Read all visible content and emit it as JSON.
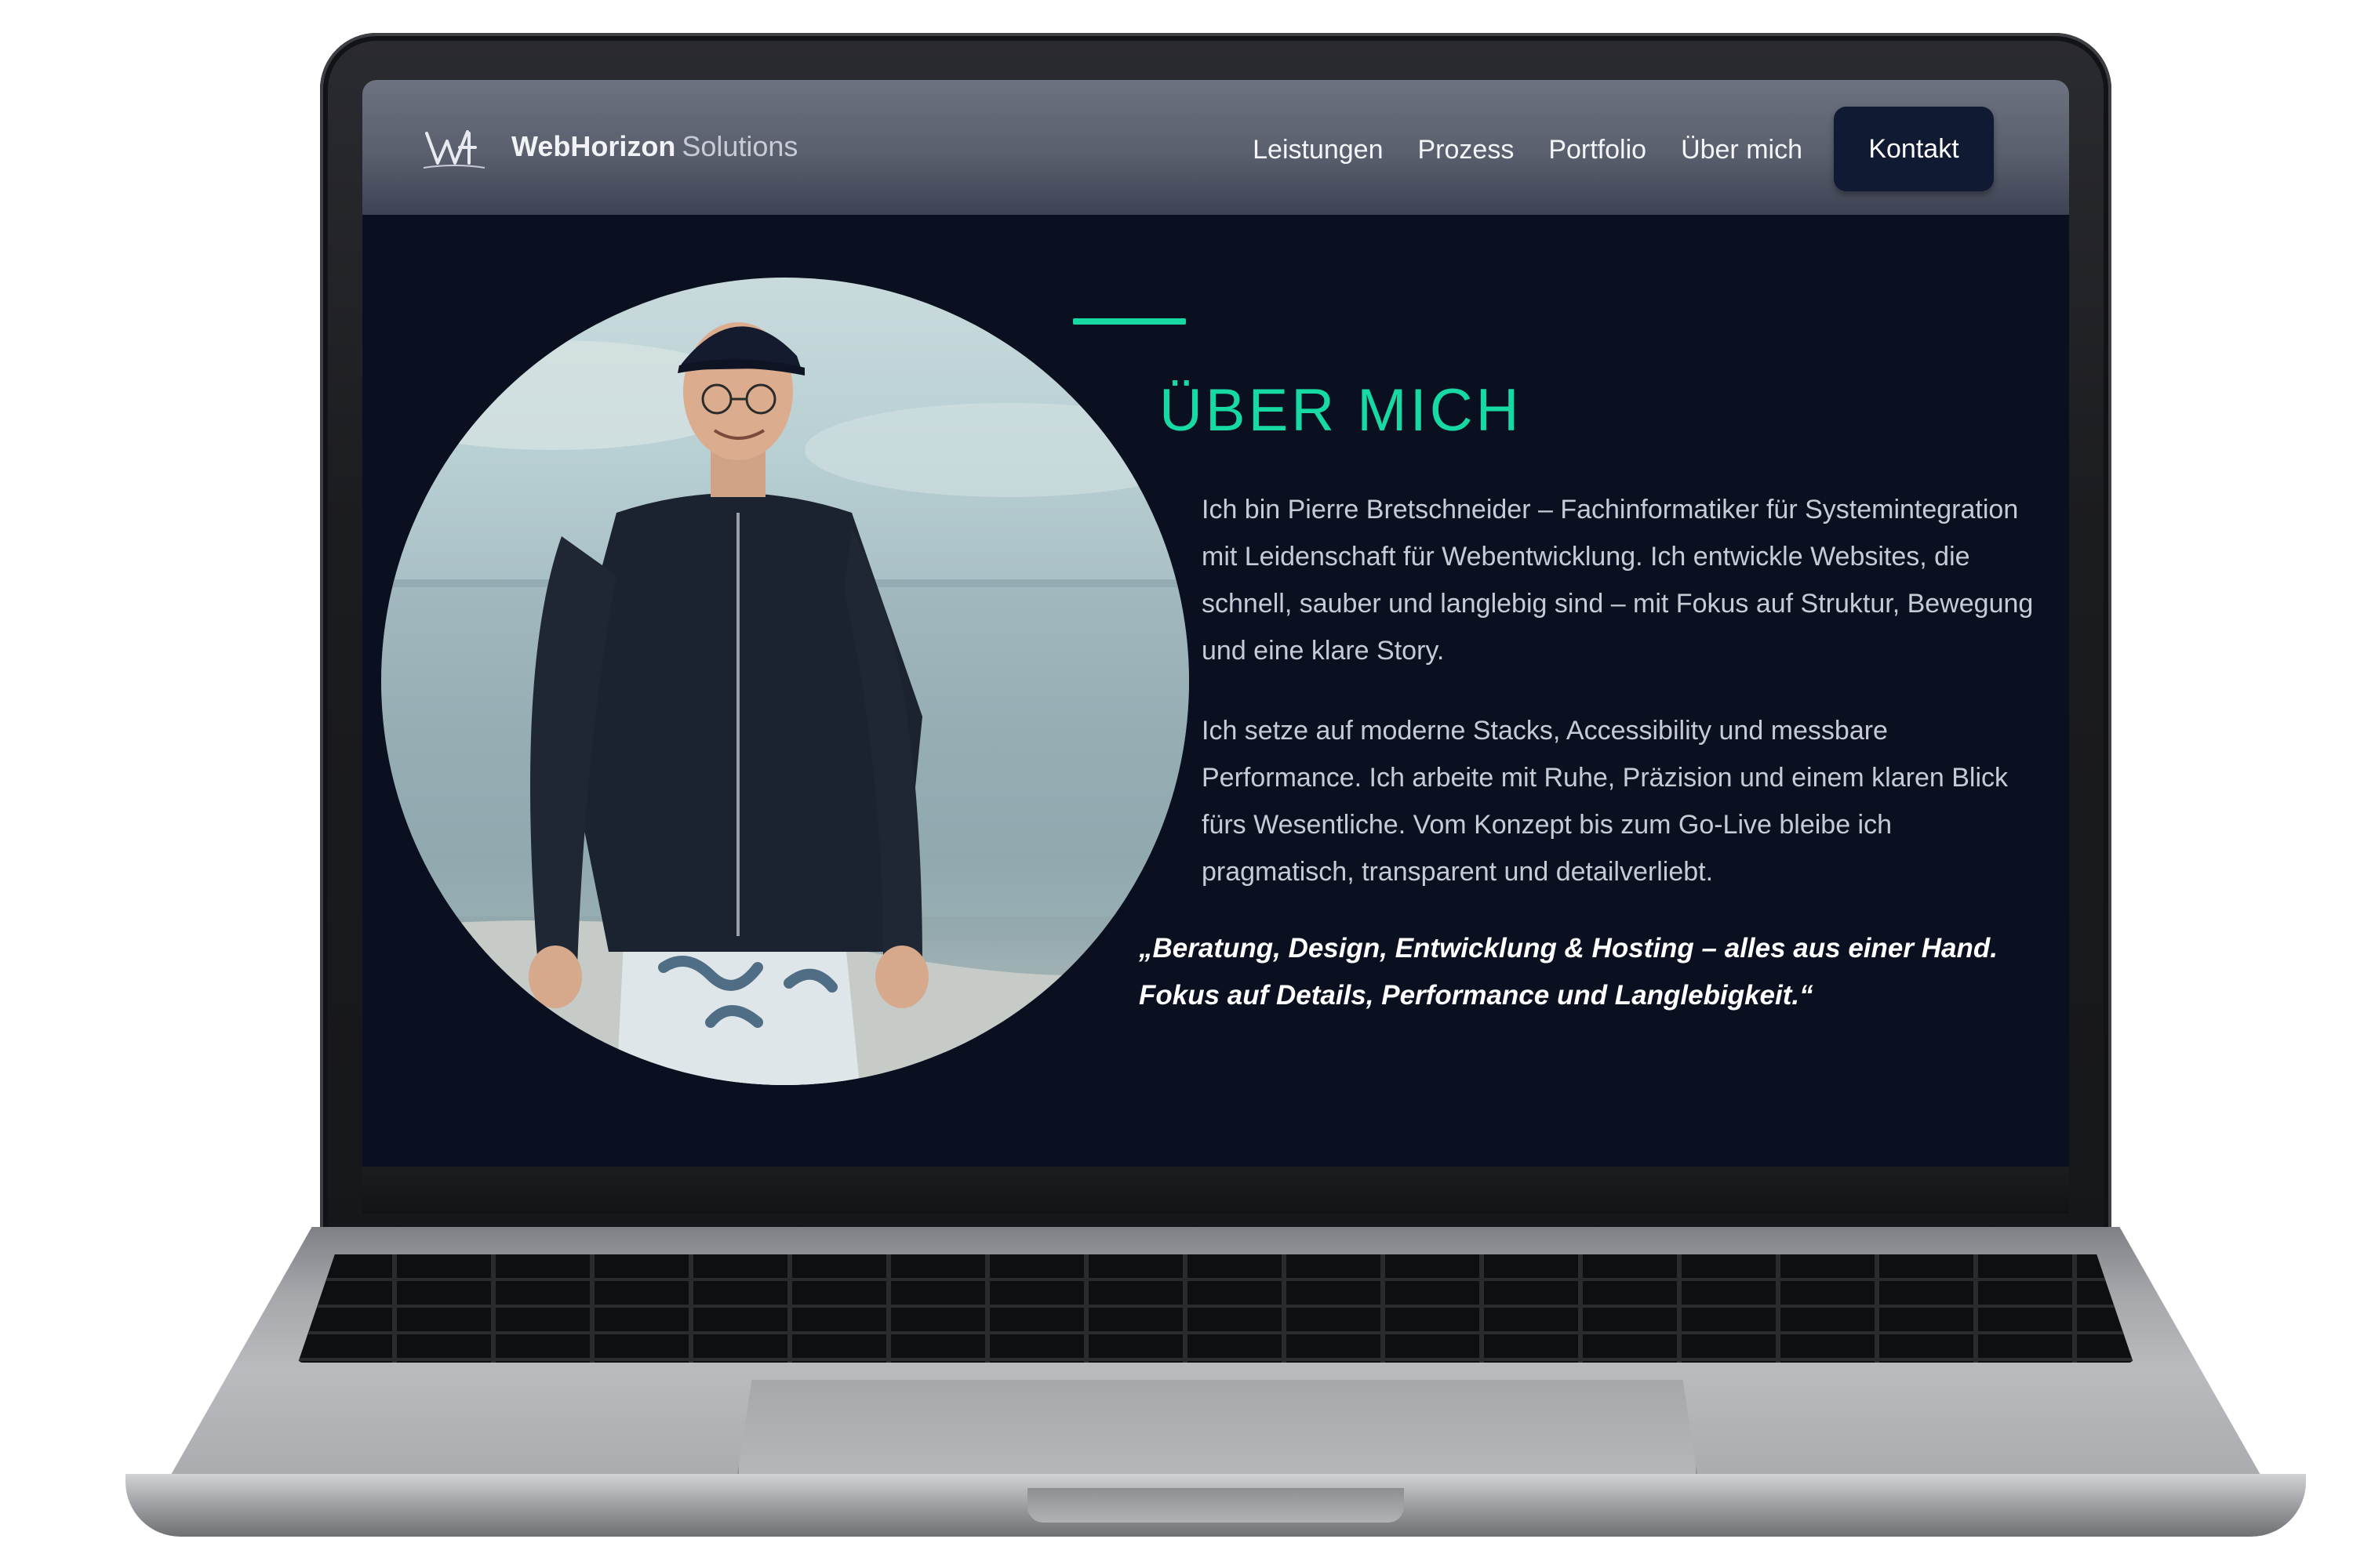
{
  "nav": {
    "brand_bold": "WebHorizon",
    "brand_light": "Solutions",
    "links": [
      "Leistungen",
      "Prozess",
      "Portfolio",
      "Über mich"
    ],
    "cta": "Kontakt"
  },
  "about": {
    "heading": "ÜBER MICH",
    "paragraph1": "Ich bin Pierre Bretschneider – Fachinformatiker für Systemintegration mit Leidenschaft für Webentwicklung. Ich entwickle Websites, die schnell, sauber und langlebig sind – mit Fokus auf Struktur, Bewegung und eine klare Story.",
    "paragraph2": "Ich setze auf moderne Stacks, Accessibility und messbare Performance. Ich arbeite mit Ruhe, Präzision und einem klaren Blick fürs Wesentliche. Vom Konzept bis zum Go-Live bleibe ich pragmatisch, transparent und detailverliebt.",
    "quote": "„Beratung, Design, Entwicklung & Hosting – alles aus einer Hand. Fokus auf Details, Performance und Langlebigkeit.“"
  },
  "colors": {
    "accent": "#16d9a3",
    "page_bg": "#0b1020",
    "cta_bg": "#111a33"
  },
  "icons": {
    "logo": "wh-logo-icon"
  }
}
